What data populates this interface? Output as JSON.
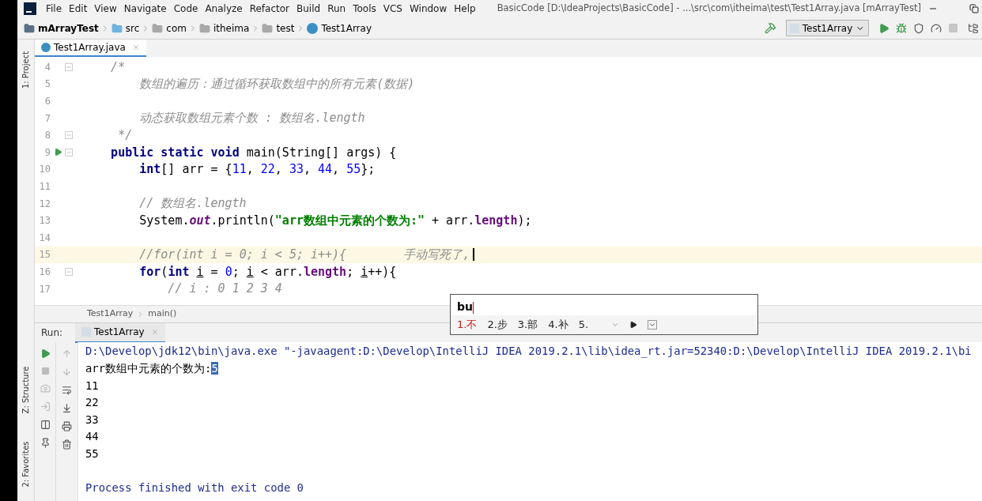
{
  "menu_bar": {
    "items": [
      "File",
      "Edit",
      "View",
      "Navigate",
      "Code",
      "Analyze",
      "Refactor",
      "Build",
      "Run",
      "Tools",
      "VCS",
      "Window",
      "Help"
    ],
    "title": "BasicCode [D:\\IdeaProjects\\BasicCode] - ...\\src\\com\\itheima\\test\\Test1Array.java [mArrayTest]"
  },
  "nav_bar": {
    "breadcrumbs": [
      {
        "label": "mArrayTest",
        "kind": "module"
      },
      {
        "label": "src",
        "kind": "source"
      },
      {
        "label": "com",
        "kind": "package"
      },
      {
        "label": "itheima",
        "kind": "package"
      },
      {
        "label": "test",
        "kind": "package"
      },
      {
        "label": "Test1Array",
        "kind": "class"
      }
    ],
    "run_config": "Test1Array"
  },
  "side_tools": {
    "top": [
      "1: Project"
    ],
    "bottom": [
      "Z: Structure",
      "2: Favorites"
    ]
  },
  "editor": {
    "tabs": [
      {
        "label": "Test1Array.java",
        "selected": true
      }
    ],
    "lines": [
      {
        "number": "4",
        "fold": true,
        "run": false,
        "current": false,
        "tokens": [
          {
            "kind": "comment",
            "text": "    /*"
          }
        ]
      },
      {
        "number": "5",
        "fold": false,
        "run": false,
        "current": false,
        "tokens": [
          {
            "kind": "comment",
            "text": "        数组的遍历：通过循环获取数组中的所有元素(数据)"
          }
        ]
      },
      {
        "number": "6",
        "fold": false,
        "run": false,
        "current": false
      },
      {
        "number": "7",
        "fold": false,
        "run": false,
        "current": false,
        "tokens": [
          {
            "kind": "comment",
            "text": "        动态获取数组元素个数 : 数组名.length"
          }
        ]
      },
      {
        "number": "8",
        "fold": true,
        "run": false,
        "current": false,
        "tokens": [
          {
            "kind": "comment",
            "text": "     */"
          }
        ]
      },
      {
        "number": "9",
        "fold": true,
        "run": true,
        "current": false,
        "tokens": [
          {
            "kind": "keyword",
            "text": "    public static void "
          },
          {
            "kind": "plain",
            "text": "main(String[] args) {"
          }
        ]
      },
      {
        "number": "10",
        "fold": false,
        "run": false,
        "current": false,
        "tokens": [
          {
            "kind": "keyword",
            "text": "        int"
          },
          {
            "kind": "plain",
            "text": "[] arr = {"
          },
          {
            "kind": "number",
            "text": "11"
          },
          {
            "kind": "plain",
            "text": ", "
          },
          {
            "kind": "number",
            "text": "22"
          },
          {
            "kind": "plain",
            "text": ", "
          },
          {
            "kind": "number",
            "text": "33"
          },
          {
            "kind": "plain",
            "text": ", "
          },
          {
            "kind": "number",
            "text": "44"
          },
          {
            "kind": "plain",
            "text": ", "
          },
          {
            "kind": "number",
            "text": "55"
          },
          {
            "kind": "plain",
            "text": "};"
          }
        ]
      },
      {
        "number": "11",
        "fold": false,
        "run": false,
        "current": false
      },
      {
        "number": "12",
        "fold": false,
        "run": false,
        "current": false,
        "tokens": [
          {
            "kind": "comment",
            "text": "        // 数组名.length"
          }
        ]
      },
      {
        "number": "13",
        "fold": false,
        "run": false,
        "current": false,
        "tokens": [
          {
            "kind": "plain",
            "text": "        System."
          },
          {
            "kind": "static",
            "text": "out"
          },
          {
            "kind": "plain",
            "text": ".println("
          },
          {
            "kind": "string",
            "text": "\"arr数组中元素的个数为:\""
          },
          {
            "kind": "plain",
            "text": " + arr."
          },
          {
            "kind": "member",
            "text": "length"
          },
          {
            "kind": "plain",
            "text": ");"
          }
        ]
      },
      {
        "number": "14",
        "fold": false,
        "run": false,
        "current": false
      },
      {
        "number": "15",
        "fold": false,
        "run": false,
        "current": true,
        "tokens": [
          {
            "kind": "comment",
            "text": "        //for(int i = 0; i < 5; i++){        手动写死了,"
          }
        ]
      },
      {
        "number": "16",
        "fold": true,
        "run": false,
        "current": false,
        "tokens": [
          {
            "kind": "keyword",
            "text": "        for"
          },
          {
            "kind": "plain",
            "text": "("
          },
          {
            "kind": "keyword",
            "text": "int "
          },
          {
            "kind": "variable",
            "text": "i"
          },
          {
            "kind": "plain",
            "text": " = "
          },
          {
            "kind": "number",
            "text": "0"
          },
          {
            "kind": "plain",
            "text": "; "
          },
          {
            "kind": "variable",
            "text": "i"
          },
          {
            "kind": "plain",
            "text": " < arr."
          },
          {
            "kind": "member",
            "text": "length"
          },
          {
            "kind": "plain",
            "text": "; "
          },
          {
            "kind": "variable",
            "text": "i"
          },
          {
            "kind": "plain",
            "text": "++){"
          }
        ]
      },
      {
        "number": "17",
        "fold": false,
        "run": false,
        "current": false,
        "tokens": [
          {
            "kind": "comment",
            "text": "            // i : 0 1 2 3 4"
          }
        ]
      }
    ],
    "breadcrumbs": [
      "Test1Array",
      "main()"
    ]
  },
  "ime": {
    "composition": "bu",
    "candidates": [
      {
        "label": "1.不",
        "selected": true
      },
      {
        "label": "2.步",
        "selected": false
      },
      {
        "label": "3.部",
        "selected": false
      },
      {
        "label": "4.补",
        "selected": false
      },
      {
        "label": "5.",
        "selected": false
      }
    ]
  },
  "run_panel": {
    "label": "Run:",
    "tabs": [
      {
        "label": "Test1Array",
        "selected": true
      }
    ],
    "console": [
      {
        "kind": "command",
        "parts": [
          {
            "text": "D:\\Develop\\jdk12\\bin\\java.exe \"-javaagent:D:\\Develop\\IntelliJ IDEA 2019.2.1\\lib\\idea_rt.jar=52340:D:\\Develop\\IntelliJ IDEA 2019.2.1\\bi",
            "selected": false
          }
        ]
      },
      {
        "kind": "output",
        "parts": [
          {
            "text": "arr数组中元素的个数为:",
            "selected": false
          },
          {
            "text": "5",
            "selected": true
          }
        ]
      },
      {
        "kind": "output",
        "parts": [
          {
            "text": "11",
            "selected": false
          }
        ]
      },
      {
        "kind": "output",
        "parts": [
          {
            "text": "22",
            "selected": false
          }
        ]
      },
      {
        "kind": "output",
        "parts": [
          {
            "text": "33",
            "selected": false
          }
        ]
      },
      {
        "kind": "output",
        "parts": [
          {
            "text": "44",
            "selected": false
          }
        ]
      },
      {
        "kind": "output",
        "parts": [
          {
            "text": "55",
            "selected": false
          }
        ]
      },
      {
        "kind": "blank"
      },
      {
        "kind": "command",
        "parts": [
          {
            "text": "Process finished with exit code 0",
            "selected": false
          }
        ]
      }
    ]
  }
}
